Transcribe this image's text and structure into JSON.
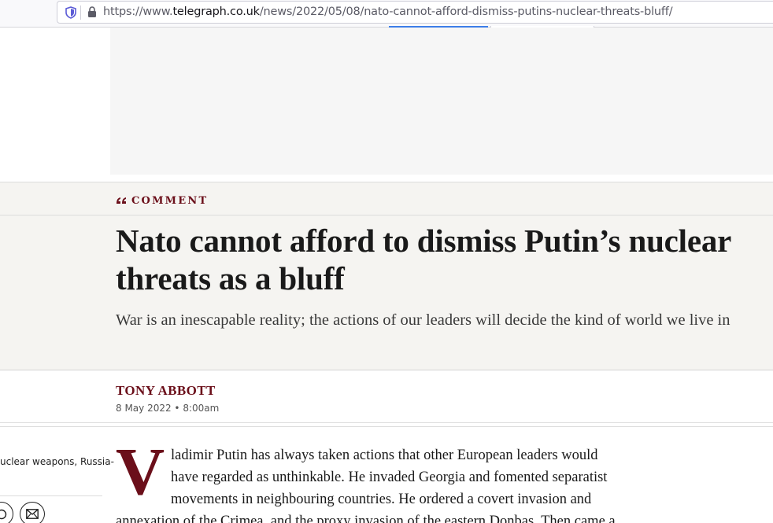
{
  "browser": {
    "url_prefix": "https://www.",
    "url_domain": "telegraph.co.uk",
    "url_path": "/news/2022/05/08/nato-cannot-afford-dismiss-putins-nuclear-threats-bluff/",
    "icons": [
      "shield-icon",
      "lock-icon"
    ]
  },
  "article": {
    "section": "COMMENT",
    "headline": "Nato cannot afford to dismiss Putin’s nuclear threats as a bluff",
    "standfirst": "War is an inescapable reality; the actions of our leaders will decide the kind of world we live in",
    "author": "TONY ABBOTT",
    "date": "8 May 2022 • 8:00am",
    "drop_cap": "V",
    "body_lines": [
      "ladimir Putin has always taken actions that other European leaders would",
      "have regarded as unthinkable. He invaded Georgia and fomented separatist",
      "movements in neighbouring countries. He ordered a covert invasion and",
      "annexation of the Crimea, and the proxy invasion of the eastern Donbas. Then came a"
    ],
    "accent_color": "#6b0f1a"
  },
  "sidebar": {
    "topics_text": "uclear weapons, Russia-",
    "share_icons": [
      "whatsapp-icon",
      "email-icon"
    ]
  }
}
